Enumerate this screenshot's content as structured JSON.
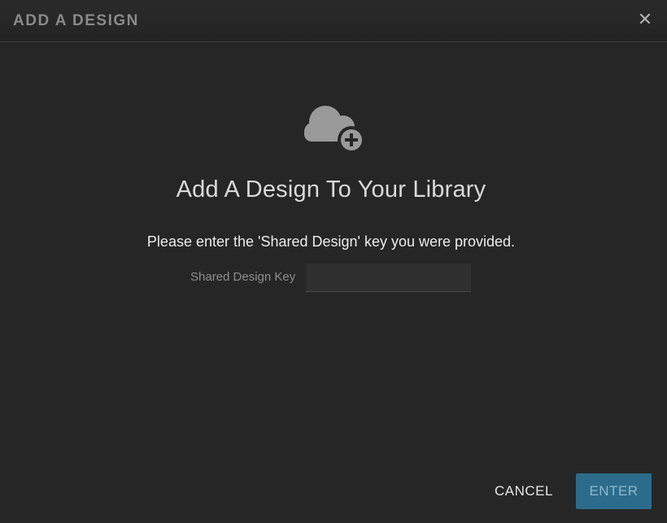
{
  "dialog": {
    "title": "ADD A DESIGN",
    "close_symbol": "✕",
    "icon": "cloud-plus-icon",
    "heading": "Add A Design To Your Library",
    "instruction": "Please enter the 'Shared Design' key you were provided.",
    "field": {
      "label": "Shared Design Key",
      "value": "",
      "placeholder": ""
    },
    "cancel_label": "CANCEL",
    "enter_label": "ENTER"
  },
  "colors": {
    "background": "#262626",
    "title_text": "#8a8a8a",
    "accent_button": "#2b6c8c",
    "icon_gray": "#9a9a9a"
  }
}
